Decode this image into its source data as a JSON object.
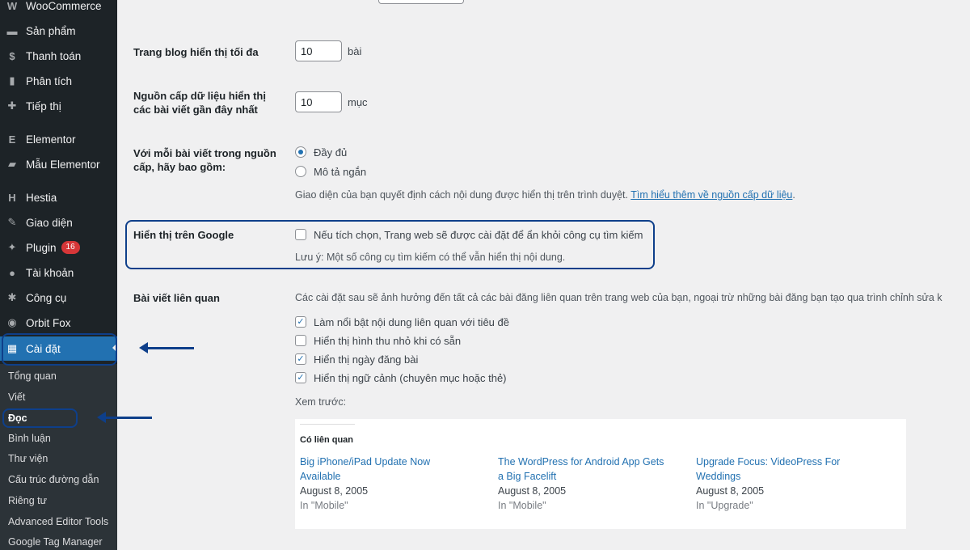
{
  "sidebar": {
    "items": [
      {
        "icon": "woocommerce-icon",
        "glyph": "W",
        "label": "WooCommerce"
      },
      {
        "icon": "products-icon",
        "glyph": "▬",
        "label": "Sản phẩm"
      },
      {
        "icon": "payments-icon",
        "glyph": "$",
        "label": "Thanh toán"
      },
      {
        "icon": "analytics-icon",
        "glyph": "▮",
        "label": "Phân tích"
      },
      {
        "icon": "marketing-icon",
        "glyph": "✚",
        "label": "Tiếp thị"
      },
      {
        "icon": "elementor-icon",
        "glyph": "E",
        "label": "Elementor"
      },
      {
        "icon": "folder-icon",
        "glyph": "▰",
        "label": "Mẫu Elementor"
      },
      {
        "icon": "hestia-icon",
        "glyph": "H",
        "label": "Hestia"
      },
      {
        "icon": "appearance-icon",
        "glyph": "✎",
        "label": "Giao diện"
      },
      {
        "icon": "plugin-icon",
        "glyph": "✦",
        "label": "Plugin",
        "badge": "16"
      },
      {
        "icon": "user-icon",
        "glyph": "●",
        "label": "Tài khoản"
      },
      {
        "icon": "tools-icon",
        "glyph": "✱",
        "label": "Công cụ"
      },
      {
        "icon": "orbit-fox-icon",
        "glyph": "◉",
        "label": "Orbit Fox"
      },
      {
        "icon": "settings-icon",
        "glyph": "▦",
        "label": "Cài đặt"
      }
    ],
    "submenu": [
      "Tổng quan",
      "Viết",
      "Đọc",
      "Bình luận",
      "Thư viện",
      "Cấu trúc đường dẫn",
      "Riêng tư",
      "Advanced Editor Tools",
      "Google Tag Manager"
    ]
  },
  "reading": {
    "blog_pages_label": "Trang blog hiển thị tối đa",
    "blog_pages_value": "10",
    "blog_pages_unit": "bài",
    "feed_label_1": "Nguồn cấp dữ liệu hiển thị",
    "feed_label_2": "các bài viết gần đây nhất",
    "feed_value": "10",
    "feed_unit": "mục",
    "feed_content_label_1": "Với mỗi bài viết trong nguồn",
    "feed_content_label_2": "cấp, hãy bao gồm:",
    "feed_full": "Đầy đủ",
    "feed_excerpt": "Mô tả ngắn",
    "feed_desc": "Giao diện của bạn quyết định cách nội dung được hiển thị trên trình duyệt. ",
    "feed_desc_link": "Tìm hiểu thêm về nguồn cấp dữ liệu",
    "feed_desc_end": ".",
    "search_label": "Hiển thị trên Google",
    "search_checkbox": "Nếu tích chọn, Trang web sẽ được cài đặt để ẩn khỏi công cụ tìm kiếm",
    "search_note": "Lưu ý: Một số công cụ tìm kiếm có thể vẫn hiển thị nội dung.",
    "related_label": "Bài viết liên quan",
    "related_desc": "Các cài đặt sau sẽ ảnh hưởng đến tất cả các bài đăng liên quan trên trang web của bạn, ngoại trừ những bài đăng bạn tạo qua trình chỉnh sửa k",
    "related_opts": [
      {
        "label": "Làm nổi bật nội dung liên quan với tiêu đề",
        "checked": "✓"
      },
      {
        "label": "Hiển thị hình thu nhỏ khi có sẵn",
        "checked": ""
      },
      {
        "label": "Hiển thị ngày đăng bài",
        "checked": "✓"
      },
      {
        "label": "Hiển thị ngữ cảnh (chuyên mục hoặc thẻ)",
        "checked": "✓"
      }
    ],
    "preview_label": "Xem trước:",
    "preview_heading": "Có liên quan",
    "preview_posts": [
      {
        "title_1": "Big iPhone/iPad Update Now",
        "title_2": "Available",
        "date": "August 8, 2005",
        "category": "In \"Mobile\""
      },
      {
        "title_1": "The WordPress for Android App Gets",
        "title_2": "a Big Facelift",
        "date": "August 8, 2005",
        "category": "In \"Mobile\""
      },
      {
        "title_1": "Upgrade Focus: VideoPress For",
        "title_2": "Weddings",
        "date": "August 8, 2005",
        "category": "In \"Upgrade\""
      }
    ]
  },
  "colors": {
    "sidebar_bg": "#1d2327",
    "accent": "#2271b1",
    "annotation": "#0e3f8a"
  }
}
